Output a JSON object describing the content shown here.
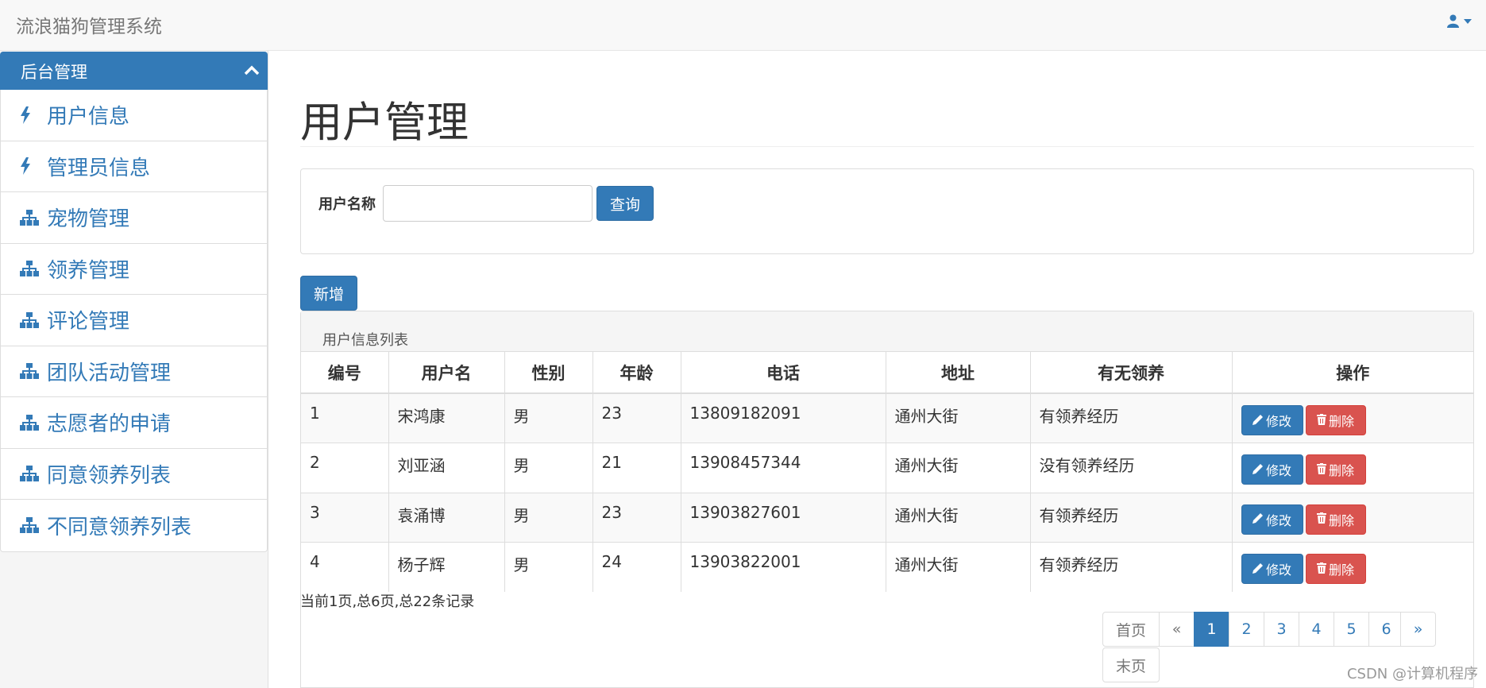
{
  "app": {
    "title": "流浪猫狗管理系统"
  },
  "sidebar": {
    "header": "后台管理",
    "items": [
      {
        "label": "用户信息",
        "icon": "bolt-icon"
      },
      {
        "label": "管理员信息",
        "icon": "bolt-icon"
      },
      {
        "label": "宠物管理",
        "icon": "sitemap-icon"
      },
      {
        "label": "领养管理",
        "icon": "sitemap-icon"
      },
      {
        "label": "评论管理",
        "icon": "sitemap-icon"
      },
      {
        "label": "团队活动管理",
        "icon": "sitemap-icon"
      },
      {
        "label": "志愿者的申请",
        "icon": "sitemap-icon"
      },
      {
        "label": "同意领养列表",
        "icon": "sitemap-icon"
      },
      {
        "label": "不同意领养列表",
        "icon": "sitemap-icon"
      }
    ]
  },
  "main": {
    "title": "用户管理",
    "search": {
      "label": "用户名称",
      "value": "",
      "button": "查询"
    },
    "add_button": "新增",
    "table": {
      "caption": "用户信息列表",
      "columns": [
        "编号",
        "用户名",
        "性别",
        "年龄",
        "电话",
        "地址",
        "有无领养",
        "操作"
      ],
      "rows": [
        {
          "id": "1",
          "name": "宋鸿康",
          "gender": "男",
          "age": "23",
          "phone": "13809182091",
          "address": "通州大街",
          "adopted": "有领养经历"
        },
        {
          "id": "2",
          "name": "刘亚涵",
          "gender": "男",
          "age": "21",
          "phone": "13908457344",
          "address": "通州大街",
          "adopted": "没有领养经历"
        },
        {
          "id": "3",
          "name": "袁涌博",
          "gender": "男",
          "age": "23",
          "phone": "13903827601",
          "address": "通州大街",
          "adopted": "有领养经历"
        },
        {
          "id": "4",
          "name": "杨子辉",
          "gender": "男",
          "age": "24",
          "phone": "13903822001",
          "address": "通州大街",
          "adopted": "有领养经历"
        }
      ],
      "edit_label": "修改",
      "delete_label": "删除"
    },
    "summary": "当前1页,总6页,总22条记录",
    "pagination": {
      "first": "首页",
      "prev": "«",
      "pages": [
        "1",
        "2",
        "3",
        "4",
        "5",
        "6"
      ],
      "current": "1",
      "next": "»",
      "last": "末页"
    }
  },
  "watermark": "CSDN @计算机程序",
  "colors": {
    "primary": "#337ab7",
    "danger": "#d9534f",
    "navbar": "#f8f8f8"
  }
}
